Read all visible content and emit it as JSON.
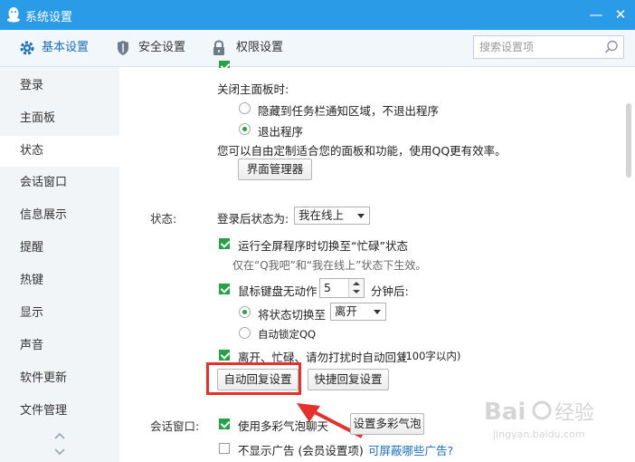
{
  "window": {
    "title": "系统设置",
    "minimize": "—",
    "close": "✕"
  },
  "toolbar": {
    "tabs": [
      {
        "label": "基本设置",
        "icon": "gear-icon"
      },
      {
        "label": "安全设置",
        "icon": "shield-icon"
      },
      {
        "label": "权限设置",
        "icon": "lock-icon"
      }
    ],
    "search_placeholder": "搜索设置项"
  },
  "sidebar": {
    "items": [
      "登录",
      "主面板",
      "状态",
      "会话窗口",
      "信息展示",
      "提醒",
      "热键",
      "显示",
      "声音",
      "软件更新",
      "文件管理"
    ],
    "active": "状态"
  },
  "content": {
    "close_panel": {
      "label": "关闭主面板时:",
      "options": [
        "隐藏到任务栏通知区域，不退出程序",
        "退出程序"
      ],
      "selected": "退出程序"
    },
    "customize_hint": "您可以自由定制适合您的面板和功能，使用QQ更有效率。",
    "interface_manager_button": "界面管理器",
    "status": {
      "section_label": "状态:",
      "after_login_label": "登录后状态为:",
      "after_login_value": "我在线上",
      "fullscreen_busy": {
        "label": "运行全屏程序时切换至“忙碌”状态",
        "checked": true
      },
      "fullscreen_hint": "仅在“Q我吧”和“我在线上”状态下生效。",
      "idle": {
        "label": "鼠标键盘无动作",
        "checked": true,
        "minutes": "5",
        "suffix": "分钟后:"
      },
      "idle_switch": {
        "label": "将状态切换至",
        "value": "离开",
        "checked": true
      },
      "idle_lock": {
        "label": "自动锁定QQ",
        "checked": false
      },
      "auto_reply": {
        "label": "离开、忙碌、请勿打扰时自动回复",
        "note": "(100字以内)",
        "checked": true
      },
      "auto_reply_button": "自动回复设置",
      "quick_reply_button": "快捷回复设置"
    },
    "chat_window": {
      "section_label": "会话窗口:",
      "bubble": {
        "label": "使用多彩气泡聊天",
        "checked": true
      },
      "bubble_button": "设置多彩气泡",
      "no_ads": {
        "label": "不显示广告 (会员设置项)",
        "checked": false
      },
      "ads_link": "可屏蔽哪些广告?"
    }
  },
  "watermark": {
    "brand": "Baidu 经验",
    "url": "jingyan.baidu.com"
  },
  "colors": {
    "titlebar": "#2a9be6",
    "accent_green": "#27a146",
    "highlight_red": "#e5312b",
    "link_blue": "#1a6fc4"
  }
}
